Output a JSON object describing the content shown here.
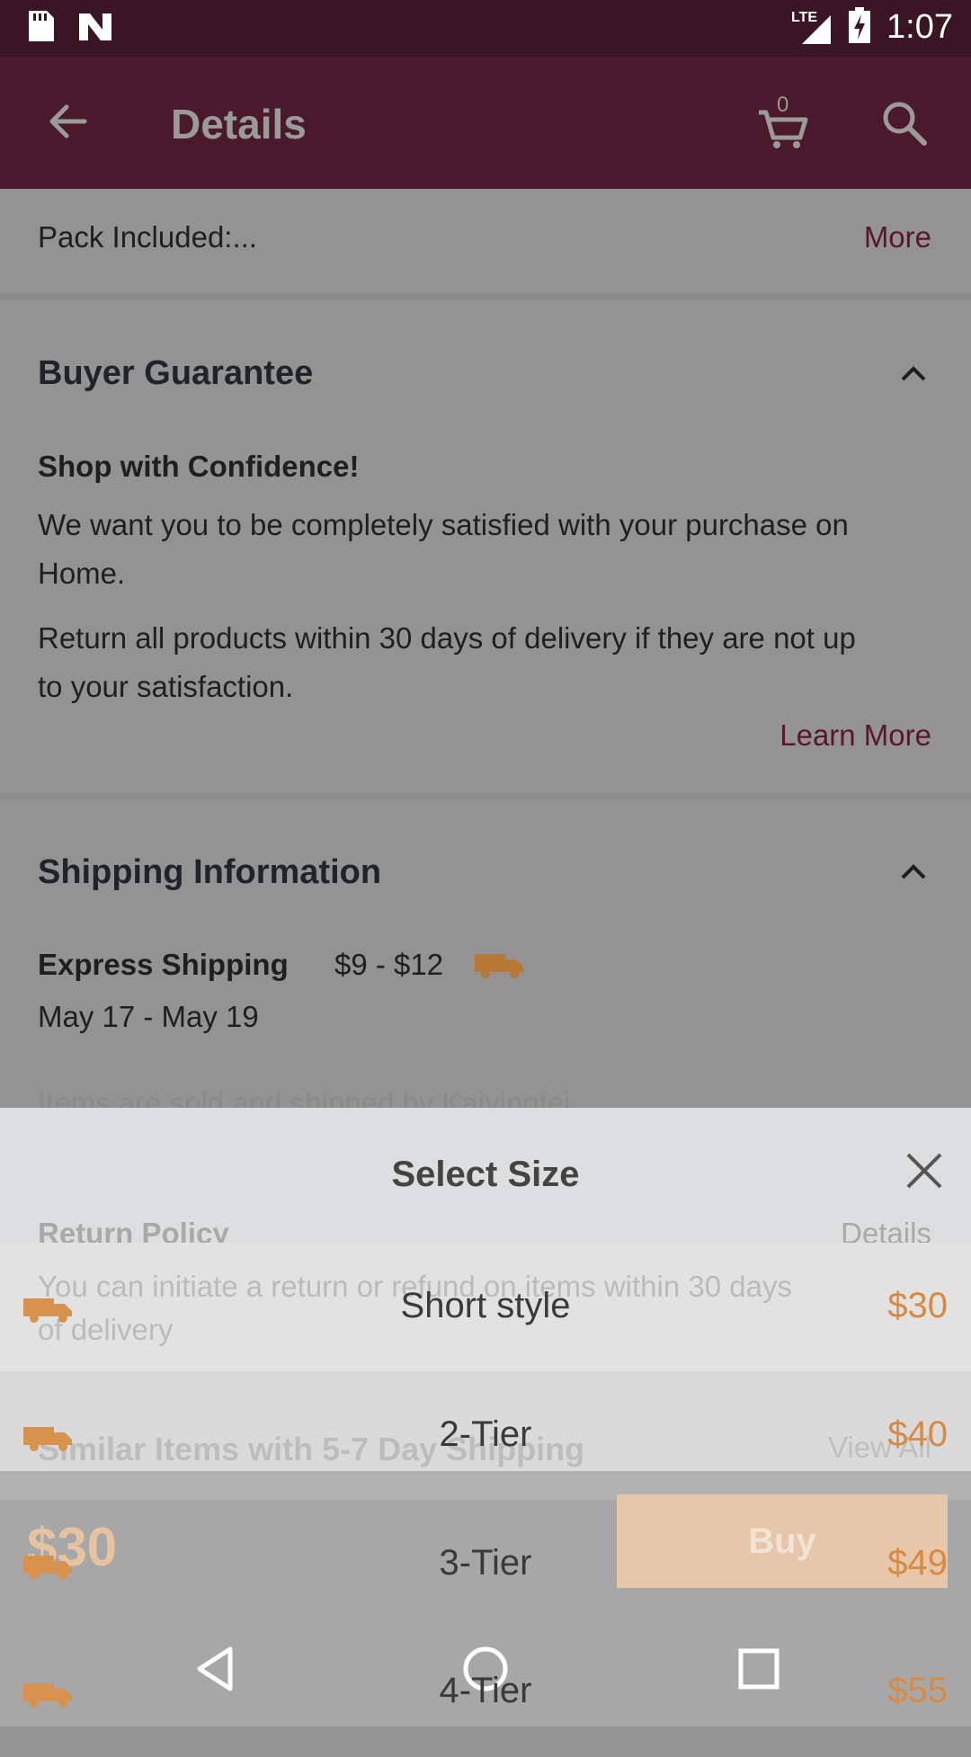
{
  "status_bar": {
    "time": "1:07",
    "network": "LTE"
  },
  "app_bar": {
    "title": "Details",
    "cart_count": "0"
  },
  "pack": {
    "label": "Pack Included:...",
    "more": "More"
  },
  "buyer_guarantee": {
    "title": "Buyer Guarantee",
    "subtitle": "Shop with Confidence!",
    "para1_line1": "We want you to be completely satisfied with your purchase on",
    "para1_line2": "Home.",
    "para2_line1": "Return all products within 30 days of delivery if they are not up",
    "para2_line2": "to your satisfaction.",
    "learn_more": "Learn More"
  },
  "shipping": {
    "title": "Shipping Information",
    "method": "Express Shipping",
    "price": "$9 - $12",
    "dates": "May 17 - May 19",
    "sold_by": "Items are sold and shipped by Kaiyingfei",
    "return_policy": "Return Policy",
    "details": "Details",
    "return_line1": "You can initiate a return or refund on items within 30 days",
    "return_line2": "of delivery",
    "similar": "Similar Items with 5-7 Day Shipping",
    "view_all": "View All"
  },
  "size_sheet": {
    "title": "Select Size",
    "options": [
      {
        "label": "Short style",
        "price": "$30"
      },
      {
        "label": "2-Tier",
        "price": "$40"
      },
      {
        "label": "3-Tier",
        "price": "$49"
      },
      {
        "label": "4-Tier",
        "price": "$55"
      }
    ]
  },
  "buy_bar": {
    "price": "$30",
    "button": "Buy"
  },
  "colors": {
    "maroon": "#4a1a2c",
    "accent_price": "#d98a40",
    "link": "#5b1530"
  }
}
